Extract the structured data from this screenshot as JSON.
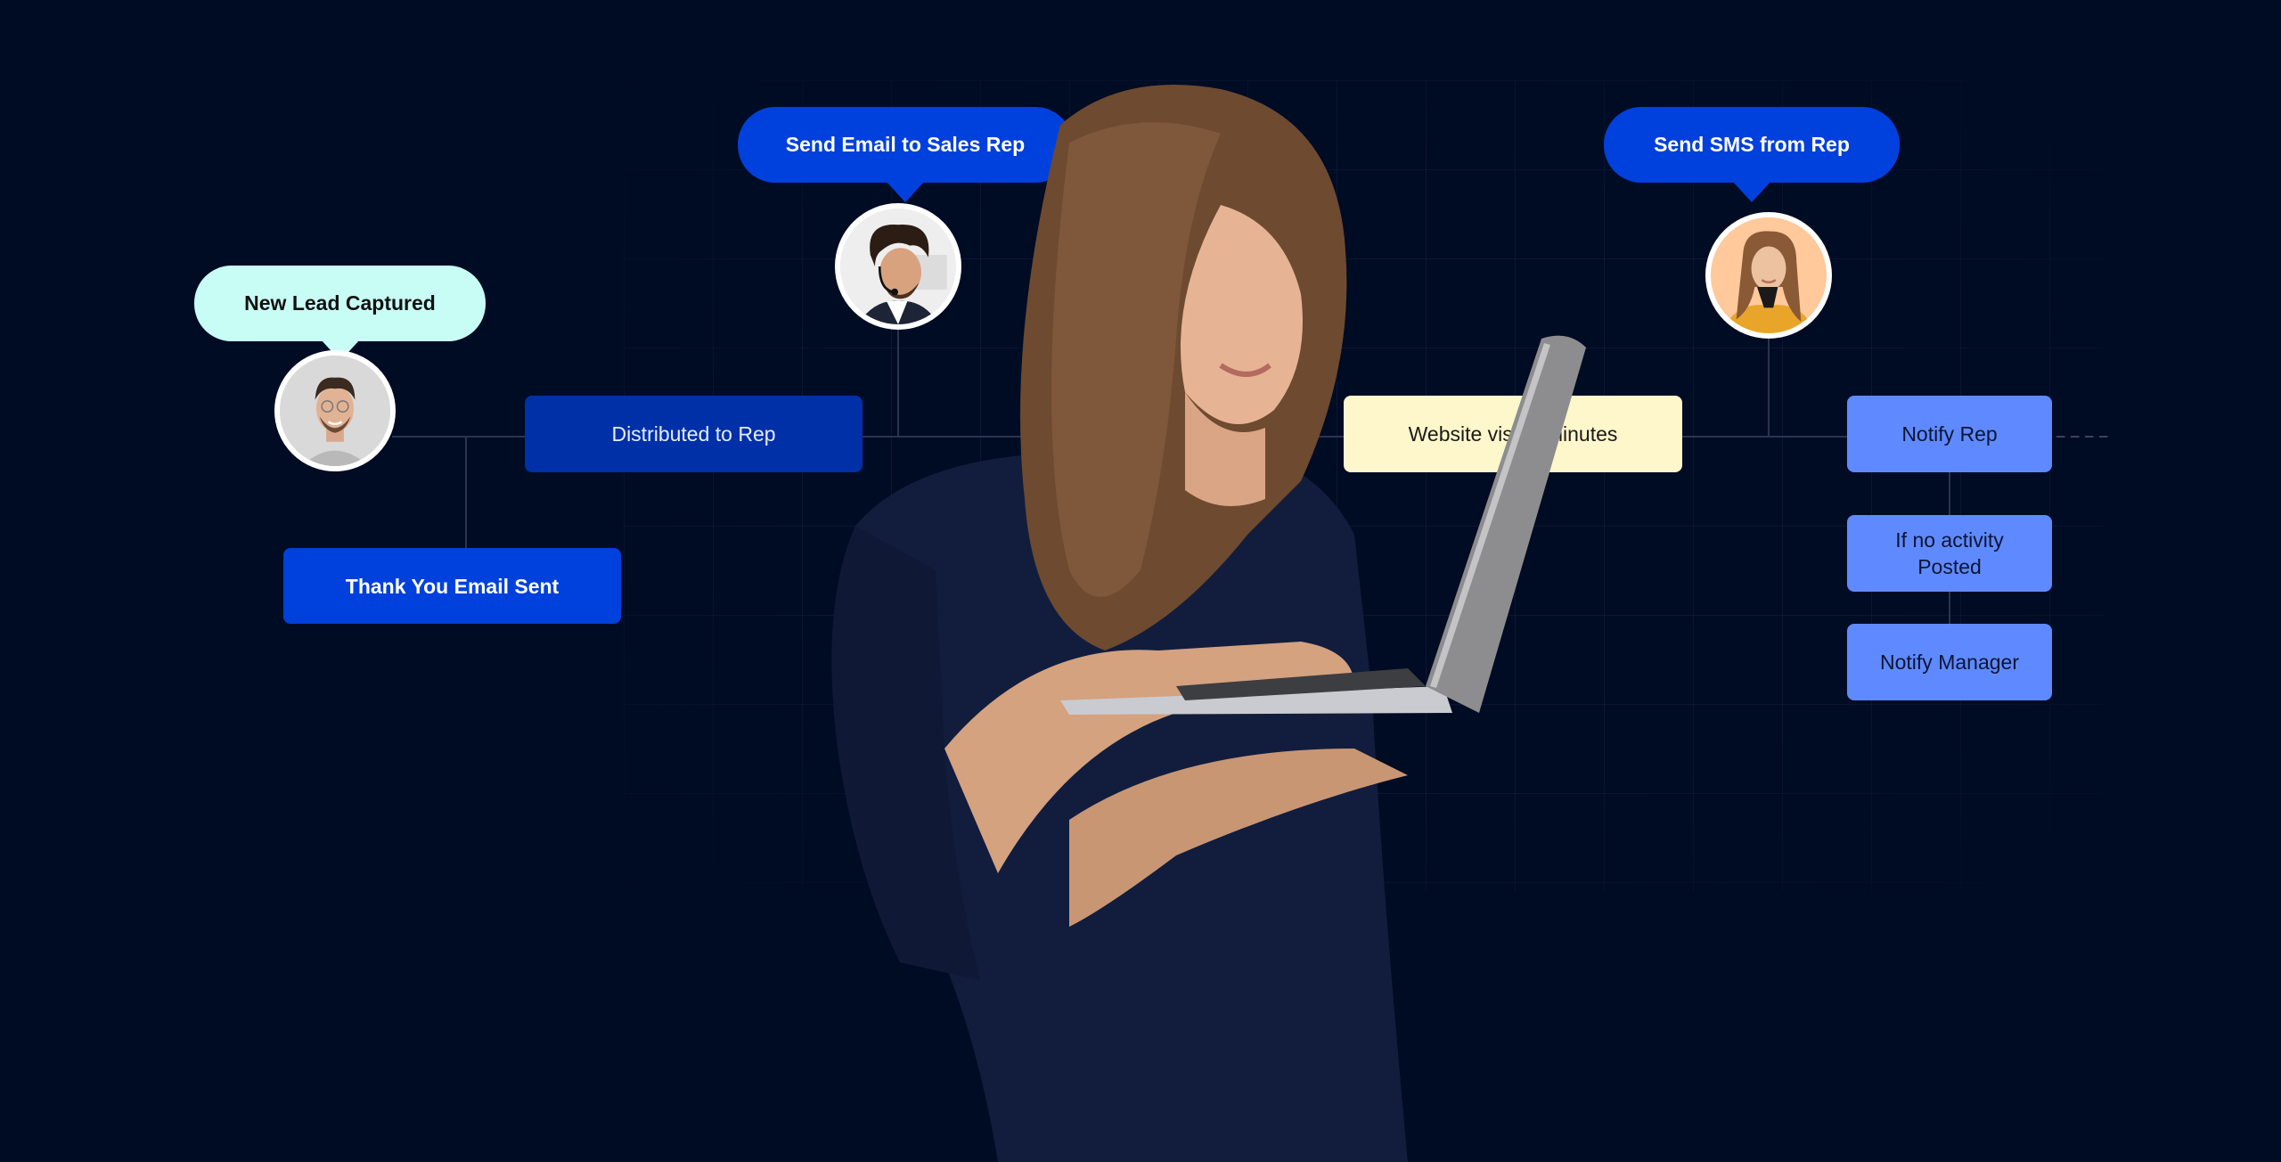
{
  "colors": {
    "background": "#000b24",
    "connector": "#2a3350",
    "mint_bubble": "#c8fdf6",
    "blue_primary": "#0040dd",
    "blue_dark": "#0030a8",
    "blue_light": "#5f8aff",
    "cream": "#fff7cc"
  },
  "workflow": {
    "trigger": {
      "label": "New Lead Captured",
      "avatar": "man-with-glasses-avatar"
    },
    "steps": {
      "distributed": "Distributed to Rep",
      "thank_you": "Thank You Email Sent",
      "send_email": "Send Email to Sales Rep",
      "website_visit": "Website visit 3 minutes",
      "send_sms": "Send SMS from Rep",
      "notify_rep": "Notify Rep",
      "if_no_activity": "If no activity Posted",
      "notify_manager": "Notify Manager"
    },
    "avatars": {
      "sales_rep": "man-with-headset-avatar",
      "sms_rep": "woman-yellow-sweater-avatar"
    }
  },
  "hero_image": "woman-holding-laptop"
}
